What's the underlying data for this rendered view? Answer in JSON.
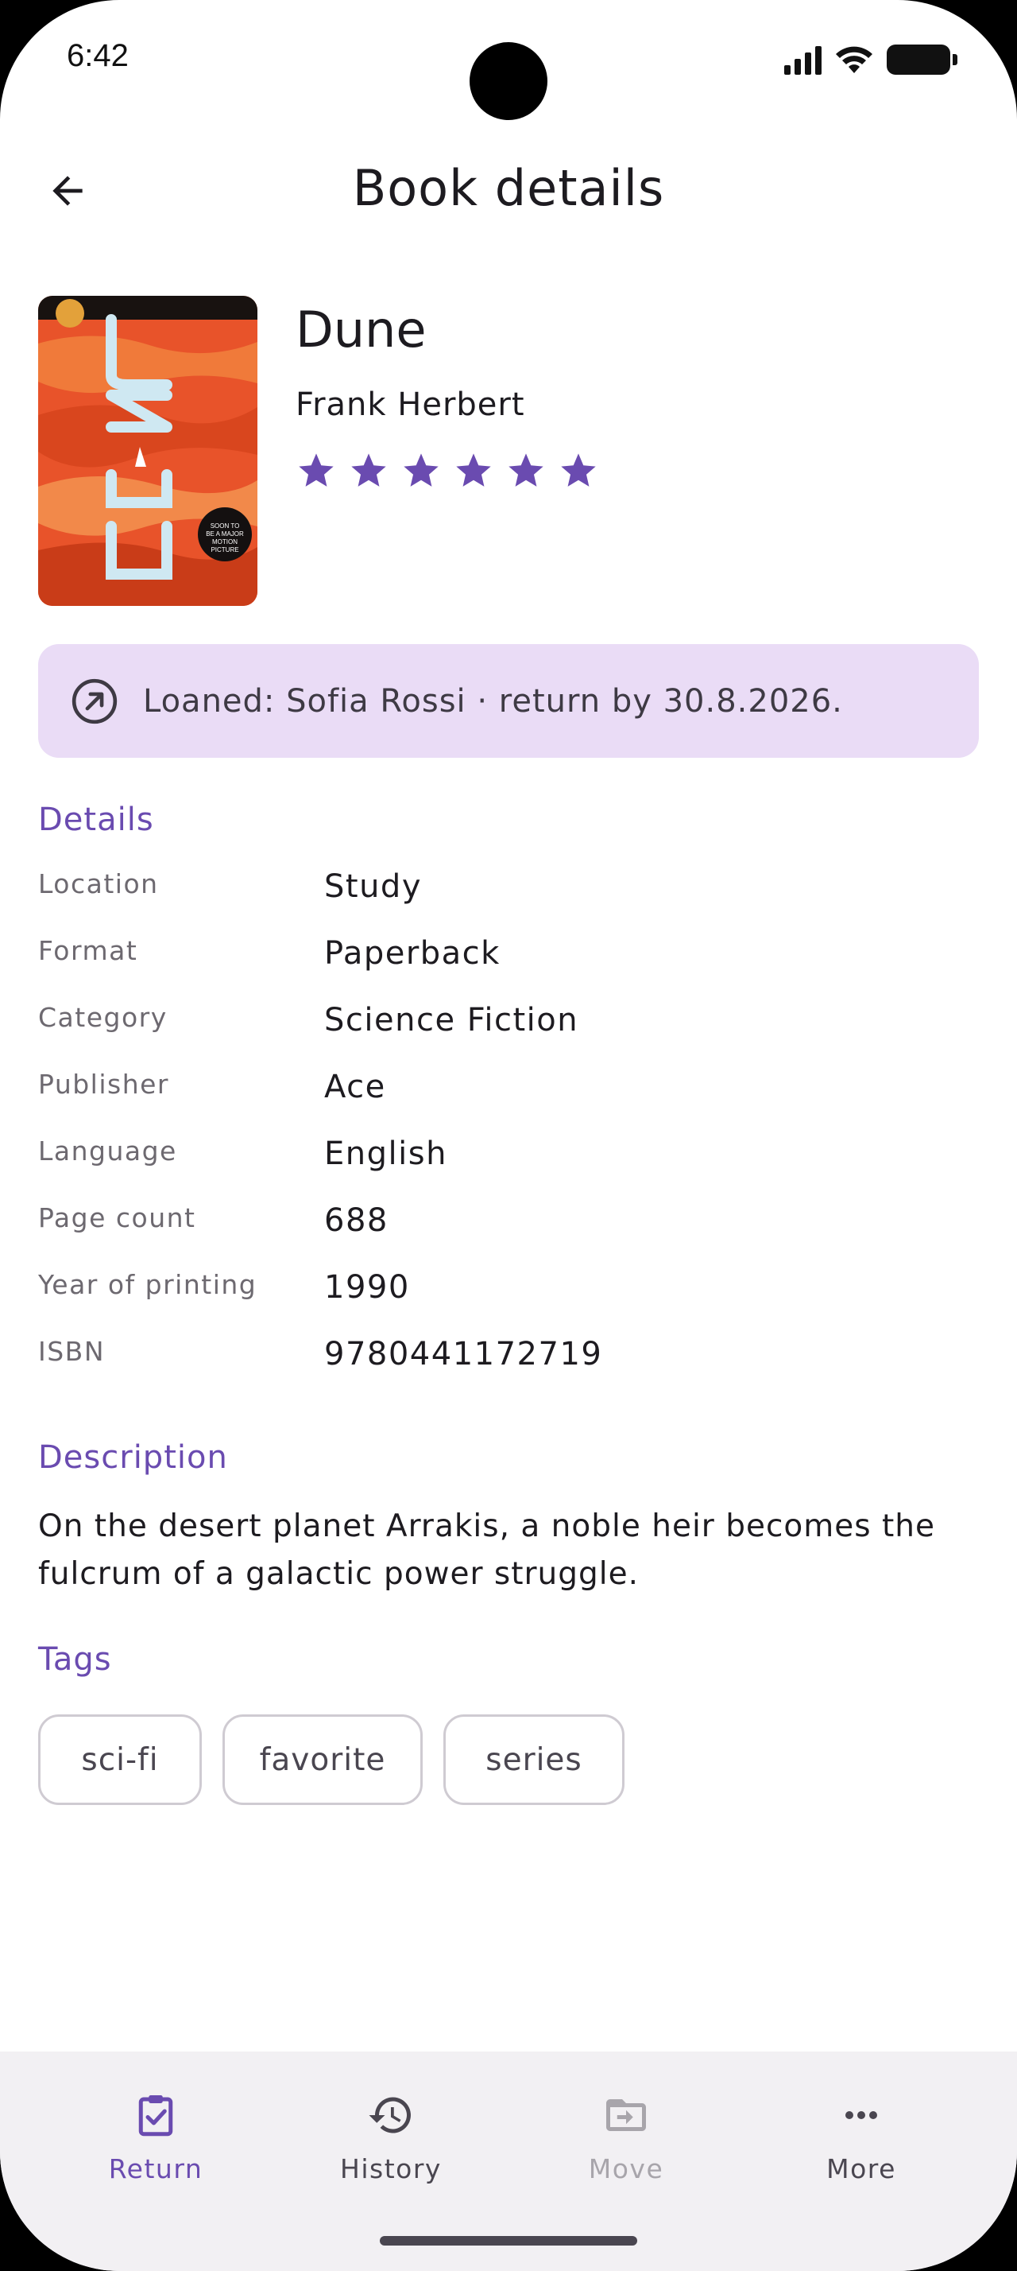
{
  "status_bar": {
    "time": "6:42"
  },
  "header": {
    "title": "Book details"
  },
  "book": {
    "title": "Dune",
    "author": "Frank Herbert",
    "rating": 6,
    "rating_max": 6,
    "cover_text": "SOON TO BE A MAJOR MOTION PICTURE"
  },
  "loan": {
    "text": "Loaned: Sofia Rossi · return by 30.8.2026."
  },
  "details": {
    "heading": "Details",
    "rows": [
      {
        "label": "Location",
        "value": "Study"
      },
      {
        "label": "Format",
        "value": "Paperback"
      },
      {
        "label": "Category",
        "value": "Science Fiction"
      },
      {
        "label": "Publisher",
        "value": "Ace"
      },
      {
        "label": "Language",
        "value": "English"
      },
      {
        "label": "Page count",
        "value": "688"
      },
      {
        "label": "Year of printing",
        "value": "1990"
      },
      {
        "label": "ISBN",
        "value": "9780441172719"
      }
    ]
  },
  "description": {
    "heading": "Description",
    "text": "On the desert planet Arrakis, a noble heir becomes the fulcrum of a galactic power struggle."
  },
  "tags": {
    "heading": "Tags",
    "items": [
      "sci-fi",
      "favorite",
      "series"
    ]
  },
  "bottom_nav": {
    "items": [
      {
        "label": "Return",
        "icon": "clipboard-check-icon",
        "state": "active"
      },
      {
        "label": "History",
        "icon": "history-icon",
        "state": "normal"
      },
      {
        "label": "Move",
        "icon": "folder-move-icon",
        "state": "disabled"
      },
      {
        "label": "More",
        "icon": "more-horizontal-icon",
        "state": "normal"
      }
    ]
  },
  "colors": {
    "accent": "#6a4bb0",
    "star": "#6a4bb0",
    "loan_banner_bg": "#eadcf6",
    "nav_bg": "#f2f0f3",
    "disabled": "#a8a5ab"
  }
}
